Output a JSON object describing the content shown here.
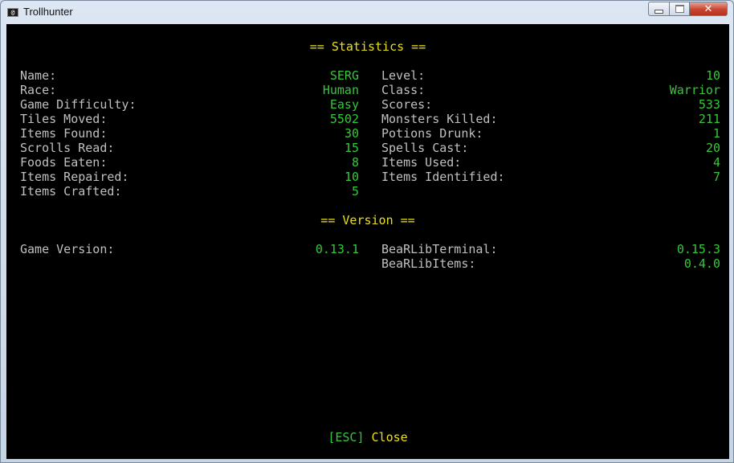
{
  "window": {
    "title": "Trollhunter",
    "icon": "console-icon"
  },
  "stats_header": "== Statistics ==",
  "stats_left": [
    {
      "label": "Name:",
      "value": "SERG"
    },
    {
      "label": "Race:",
      "value": "Human"
    },
    {
      "label": "Game Difficulty:",
      "value": "Easy"
    },
    {
      "label": "Tiles Moved:",
      "value": "5502"
    },
    {
      "label": "Items Found:",
      "value": "30"
    },
    {
      "label": "Scrolls Read:",
      "value": "15"
    },
    {
      "label": "Foods Eaten:",
      "value": "8"
    },
    {
      "label": "Items Repaired:",
      "value": "10"
    },
    {
      "label": "Items Crafted:",
      "value": "5"
    }
  ],
  "stats_right": [
    {
      "label": "Level:",
      "value": "10"
    },
    {
      "label": "Class:",
      "value": "Warrior"
    },
    {
      "label": "Scores:",
      "value": "533"
    },
    {
      "label": "Monsters Killed:",
      "value": "211"
    },
    {
      "label": "Potions Drunk:",
      "value": "1"
    },
    {
      "label": "Spells Cast:",
      "value": "20"
    },
    {
      "label": "Items Used:",
      "value": "4"
    },
    {
      "label": "Items Identified:",
      "value": "7"
    }
  ],
  "version_header": "== Version ==",
  "version_left": [
    {
      "label": "Game Version:",
      "value": "0.13.1"
    }
  ],
  "version_right": [
    {
      "label": "BeaRLibTerminal:",
      "value": "0.15.3"
    },
    {
      "label": "BeaRLibItems:",
      "value": "0.4.0"
    }
  ],
  "footer": {
    "key": "[ESC]",
    "action": "Close"
  },
  "colors": {
    "label": "#c0c0c0",
    "value": "#35c83a",
    "header": "#e8e11a",
    "background": "#000000"
  }
}
